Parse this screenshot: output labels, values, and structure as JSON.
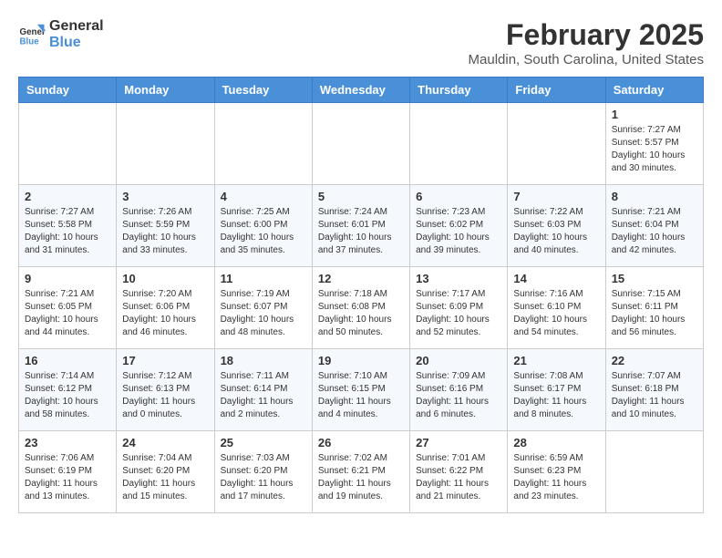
{
  "header": {
    "logo_line1": "General",
    "logo_line2": "Blue",
    "month_title": "February 2025",
    "location": "Mauldin, South Carolina, United States"
  },
  "weekdays": [
    "Sunday",
    "Monday",
    "Tuesday",
    "Wednesday",
    "Thursday",
    "Friday",
    "Saturday"
  ],
  "weeks": [
    [
      {
        "day": "",
        "info": ""
      },
      {
        "day": "",
        "info": ""
      },
      {
        "day": "",
        "info": ""
      },
      {
        "day": "",
        "info": ""
      },
      {
        "day": "",
        "info": ""
      },
      {
        "day": "",
        "info": ""
      },
      {
        "day": "1",
        "info": "Sunrise: 7:27 AM\nSunset: 5:57 PM\nDaylight: 10 hours\nand 30 minutes."
      }
    ],
    [
      {
        "day": "2",
        "info": "Sunrise: 7:27 AM\nSunset: 5:58 PM\nDaylight: 10 hours\nand 31 minutes."
      },
      {
        "day": "3",
        "info": "Sunrise: 7:26 AM\nSunset: 5:59 PM\nDaylight: 10 hours\nand 33 minutes."
      },
      {
        "day": "4",
        "info": "Sunrise: 7:25 AM\nSunset: 6:00 PM\nDaylight: 10 hours\nand 35 minutes."
      },
      {
        "day": "5",
        "info": "Sunrise: 7:24 AM\nSunset: 6:01 PM\nDaylight: 10 hours\nand 37 minutes."
      },
      {
        "day": "6",
        "info": "Sunrise: 7:23 AM\nSunset: 6:02 PM\nDaylight: 10 hours\nand 39 minutes."
      },
      {
        "day": "7",
        "info": "Sunrise: 7:22 AM\nSunset: 6:03 PM\nDaylight: 10 hours\nand 40 minutes."
      },
      {
        "day": "8",
        "info": "Sunrise: 7:21 AM\nSunset: 6:04 PM\nDaylight: 10 hours\nand 42 minutes."
      }
    ],
    [
      {
        "day": "9",
        "info": "Sunrise: 7:21 AM\nSunset: 6:05 PM\nDaylight: 10 hours\nand 44 minutes."
      },
      {
        "day": "10",
        "info": "Sunrise: 7:20 AM\nSunset: 6:06 PM\nDaylight: 10 hours\nand 46 minutes."
      },
      {
        "day": "11",
        "info": "Sunrise: 7:19 AM\nSunset: 6:07 PM\nDaylight: 10 hours\nand 48 minutes."
      },
      {
        "day": "12",
        "info": "Sunrise: 7:18 AM\nSunset: 6:08 PM\nDaylight: 10 hours\nand 50 minutes."
      },
      {
        "day": "13",
        "info": "Sunrise: 7:17 AM\nSunset: 6:09 PM\nDaylight: 10 hours\nand 52 minutes."
      },
      {
        "day": "14",
        "info": "Sunrise: 7:16 AM\nSunset: 6:10 PM\nDaylight: 10 hours\nand 54 minutes."
      },
      {
        "day": "15",
        "info": "Sunrise: 7:15 AM\nSunset: 6:11 PM\nDaylight: 10 hours\nand 56 minutes."
      }
    ],
    [
      {
        "day": "16",
        "info": "Sunrise: 7:14 AM\nSunset: 6:12 PM\nDaylight: 10 hours\nand 58 minutes."
      },
      {
        "day": "17",
        "info": "Sunrise: 7:12 AM\nSunset: 6:13 PM\nDaylight: 11 hours\nand 0 minutes."
      },
      {
        "day": "18",
        "info": "Sunrise: 7:11 AM\nSunset: 6:14 PM\nDaylight: 11 hours\nand 2 minutes."
      },
      {
        "day": "19",
        "info": "Sunrise: 7:10 AM\nSunset: 6:15 PM\nDaylight: 11 hours\nand 4 minutes."
      },
      {
        "day": "20",
        "info": "Sunrise: 7:09 AM\nSunset: 6:16 PM\nDaylight: 11 hours\nand 6 minutes."
      },
      {
        "day": "21",
        "info": "Sunrise: 7:08 AM\nSunset: 6:17 PM\nDaylight: 11 hours\nand 8 minutes."
      },
      {
        "day": "22",
        "info": "Sunrise: 7:07 AM\nSunset: 6:18 PM\nDaylight: 11 hours\nand 10 minutes."
      }
    ],
    [
      {
        "day": "23",
        "info": "Sunrise: 7:06 AM\nSunset: 6:19 PM\nDaylight: 11 hours\nand 13 minutes."
      },
      {
        "day": "24",
        "info": "Sunrise: 7:04 AM\nSunset: 6:20 PM\nDaylight: 11 hours\nand 15 minutes."
      },
      {
        "day": "25",
        "info": "Sunrise: 7:03 AM\nSunset: 6:20 PM\nDaylight: 11 hours\nand 17 minutes."
      },
      {
        "day": "26",
        "info": "Sunrise: 7:02 AM\nSunset: 6:21 PM\nDaylight: 11 hours\nand 19 minutes."
      },
      {
        "day": "27",
        "info": "Sunrise: 7:01 AM\nSunset: 6:22 PM\nDaylight: 11 hours\nand 21 minutes."
      },
      {
        "day": "28",
        "info": "Sunrise: 6:59 AM\nSunset: 6:23 PM\nDaylight: 11 hours\nand 23 minutes."
      },
      {
        "day": "",
        "info": ""
      }
    ]
  ]
}
